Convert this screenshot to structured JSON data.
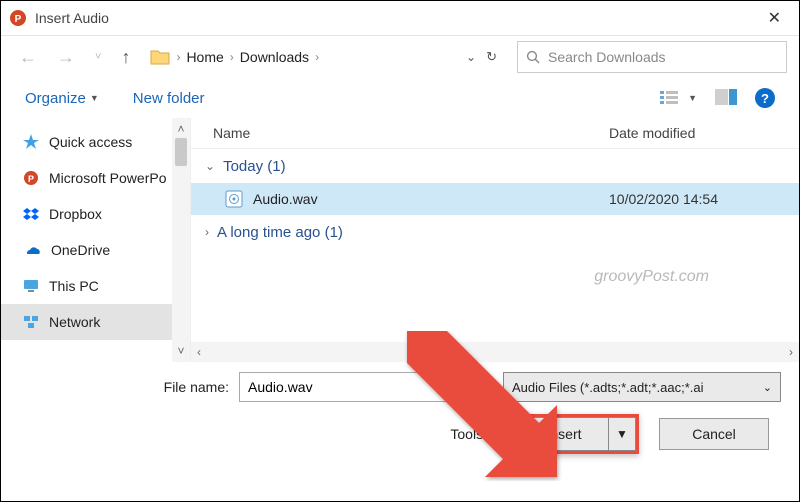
{
  "title": "Insert Audio",
  "breadcrumb": {
    "seg1": "Home",
    "seg2": "Downloads"
  },
  "search": {
    "placeholder": "Search Downloads"
  },
  "toolbar": {
    "organize": "Organize",
    "newfolder": "New folder"
  },
  "columns": {
    "name": "Name",
    "date": "Date modified"
  },
  "sidebar": {
    "items": [
      {
        "label": "Quick access"
      },
      {
        "label": "Microsoft PowerPo"
      },
      {
        "label": "Dropbox"
      },
      {
        "label": "OneDrive"
      },
      {
        "label": "This PC"
      },
      {
        "label": "Network"
      }
    ]
  },
  "groups": {
    "today": {
      "label": "Today (1)"
    },
    "old": {
      "label": "A long time ago (1)"
    }
  },
  "file": {
    "name": "Audio.wav",
    "date": "10/02/2020 14:54"
  },
  "watermark": "groovyPost.com",
  "filename_label": "File name:",
  "filename_value": "Audio.wav",
  "filetype": "Audio Files (*.adts;*.adt;*.aac;*.ai",
  "tools_label": "Tools",
  "insert_label": "Insert",
  "cancel_label": "Cancel"
}
